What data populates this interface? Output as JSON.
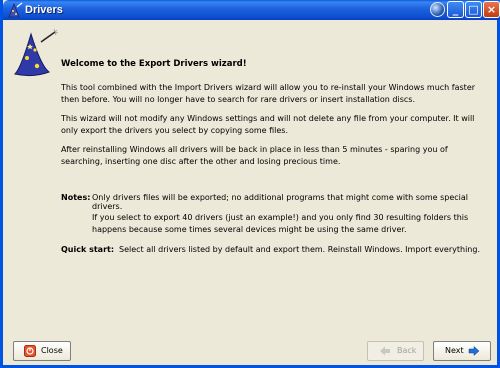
{
  "window": {
    "title": "Drivers",
    "icons": {
      "app": "wizard-app-icon",
      "globe": "globe-icon",
      "minimize": "minimize-icon",
      "maximize": "maximize-icon",
      "close": "close-icon"
    },
    "minimize_glyph": "_",
    "maximize_glyph": "□",
    "close_glyph": "×",
    "colors": {
      "titlebar": "#0a4cce",
      "background": "#ece9d8"
    }
  },
  "wizard": {
    "heading": "Welcome to the Export Drivers wizard!",
    "paragraph1": "This tool combined with the Import Drivers wizard will allow you to re-install your Windows much faster then before. You will no longer have to search for rare drivers or insert installation discs.",
    "paragraph2": "This wizard will not modify any Windows settings and will not delete any file from your computer. It will only export the drivers you select by copying some files.",
    "paragraph3": "After reinstalling Windows all drivers will be back in place in less than 5 minutes - sparing you of searching, inserting one disc after the other and losing precious time.",
    "notes_label": "Notes:",
    "note1": "Only drivers files will be exported; no additional programs that might come with some special drivers.",
    "note2": "If you select to export 40 drivers (just an example!) and you only find 30 resulting folders this happens because some times several devices might be using the same driver.",
    "quickstart_label": "Quick start:",
    "quickstart_text": "Select all drivers listed by default and export them. Reinstall Windows. Import everything."
  },
  "buttons": {
    "close_label": "Close",
    "back_label": "Back",
    "next_label": "Next",
    "close_icon": "close-circle-icon",
    "back_icon": "arrow-left-icon",
    "next_icon": "arrow-right-icon",
    "back_enabled": false
  }
}
